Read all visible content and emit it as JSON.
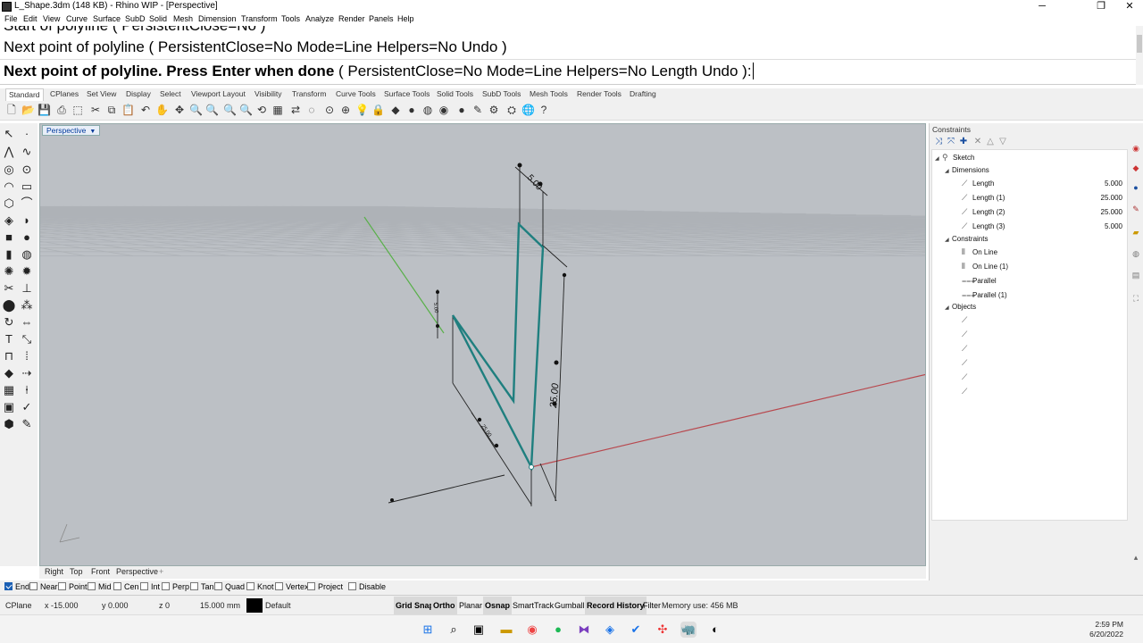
{
  "window": {
    "title": "L_Shape.3dm (148 KB) - Rhino WIP - [Perspective]",
    "minimize": "─",
    "restore": "❐",
    "close": "✕"
  },
  "menu": [
    "File",
    "Edit",
    "View",
    "Curve",
    "Surface",
    "SubD",
    "Solid",
    "Mesh",
    "Dimension",
    "Transform",
    "Tools",
    "Analyze",
    "Render",
    "Panels",
    "Help"
  ],
  "command": {
    "history_1": "Start of polyline ( PersistentClose=No )",
    "history_2": "Next point of polyline ( PersistentClose=No  Mode=Line  Helpers=No  Undo )",
    "prompt_bold": "Next point of polyline. Press Enter when done",
    "prompt_opts": " ( PersistentClose=No  Mode=Line  Helpers=No  Length  Undo ):"
  },
  "toolbar_tabs": [
    "Standard",
    "CPlanes",
    "Set View",
    "Display",
    "Select",
    "Viewport Layout",
    "Visibility",
    "Transform",
    "Curve Tools",
    "Surface Tools",
    "Solid Tools",
    "SubD Tools",
    "Mesh Tools",
    "Render Tools",
    "Drafting"
  ],
  "viewport": {
    "name": "Perspective",
    "dim_labels": {
      "top": "5.00",
      "right": "25.00",
      "bottom": "25.00",
      "left": "5.00"
    }
  },
  "viewport_tabs": [
    "Right",
    "Top",
    "Front",
    "Perspective",
    "+"
  ],
  "panel": {
    "title": "Constraints",
    "tree": {
      "root": "Sketch",
      "dimensions_label": "Dimensions",
      "dimensions": [
        {
          "name": "Length",
          "value": "5.000"
        },
        {
          "name": "Length (1)",
          "value": "25.000"
        },
        {
          "name": "Length (2)",
          "value": "25.000"
        },
        {
          "name": "Length (3)",
          "value": "5.000"
        }
      ],
      "constraints_label": "Constraints",
      "constraints": [
        "On Line",
        "On Line (1)",
        "Parallel",
        "Parallel (1)"
      ],
      "objects_label": "Objects"
    }
  },
  "osnaps": [
    {
      "label": "End",
      "checked": true
    },
    {
      "label": "Near",
      "checked": false
    },
    {
      "label": "Point",
      "checked": false
    },
    {
      "label": "Mid",
      "checked": false
    },
    {
      "label": "Cen",
      "checked": false
    },
    {
      "label": "Int",
      "checked": false
    },
    {
      "label": "Perp",
      "checked": false
    },
    {
      "label": "Tan",
      "checked": false
    },
    {
      "label": "Quad",
      "checked": false
    },
    {
      "label": "Knot",
      "checked": false
    },
    {
      "label": "Vertex",
      "checked": false
    },
    {
      "label": "Project",
      "checked": false
    },
    {
      "label": "Disable",
      "checked": false
    }
  ],
  "status": {
    "cplane": "CPlane",
    "x": "x -15.000",
    "y": "y 0.000",
    "z": "z 0",
    "distance": "15.000 mm",
    "layer": "Default",
    "grid_snap": "Grid Snap",
    "ortho": "Ortho",
    "planar": "Planar",
    "osnap": "Osnap",
    "smarttrack": "SmartTrack",
    "gumball": "Gumball",
    "record_history": "Record History",
    "filter": "Filter",
    "memory": "Memory use: 456 MB"
  },
  "clock": {
    "time": "2:59 PM",
    "date": "6/20/2022"
  }
}
